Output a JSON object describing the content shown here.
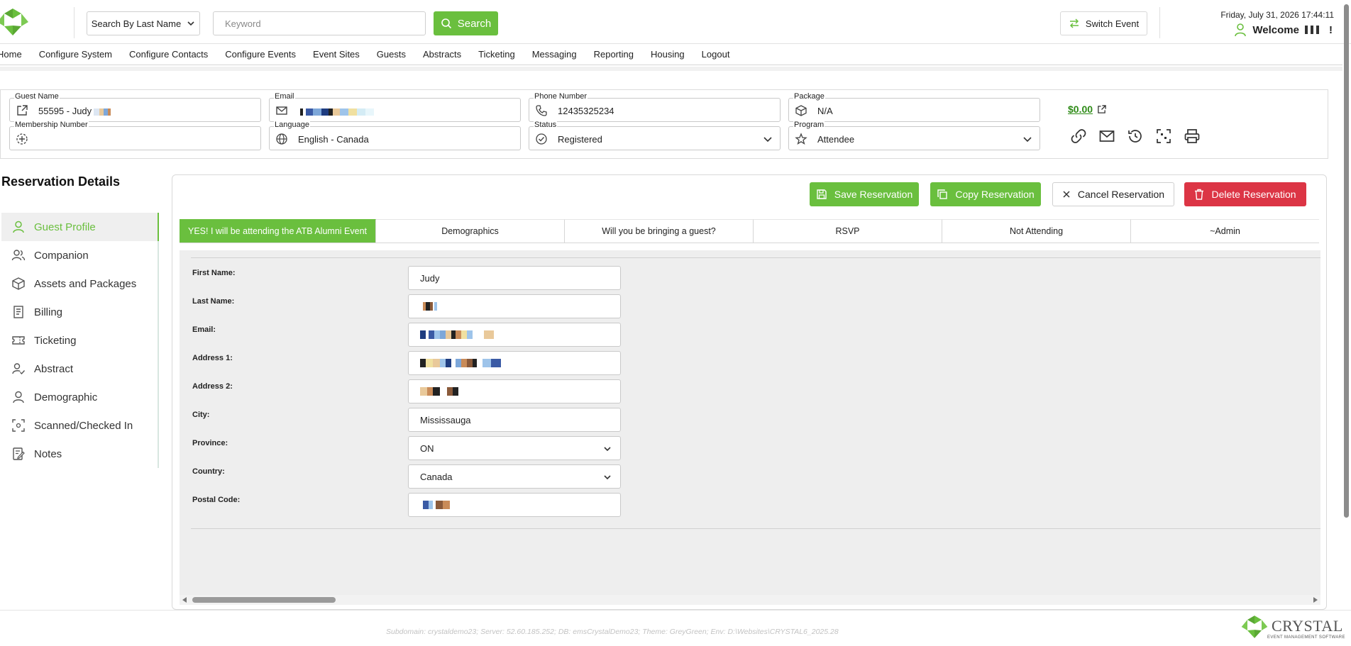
{
  "header": {
    "search_type": "Search By Last Name",
    "keyword_placeholder": "Keyword",
    "search_label": "Search",
    "switch_event_label": "Switch Event",
    "datetime": "Friday, July 31, 2026 17:44:11",
    "welcome": "Welcome",
    "welcome_suffix": "!"
  },
  "nav": [
    "Home",
    "Configure System",
    "Configure Contacts",
    "Configure Events",
    "Event Sites",
    "Guests",
    "Abstracts",
    "Ticketing",
    "Messaging",
    "Reporting",
    "Housing",
    "Logout"
  ],
  "guest": {
    "name_label": "Guest Name",
    "name_value": "55595 - Judy",
    "email_label": "Email",
    "phone_label": "Phone Number",
    "phone_value": "12435325234",
    "package_label": "Package",
    "package_value": "N/A",
    "amount": "$0.00",
    "membership_label": "Membership Number",
    "membership_value": "",
    "language_label": "Language",
    "language_value": "English - Canada",
    "status_label": "Status",
    "status_value": "Registered",
    "program_label": "Program",
    "program_value": "Attendee"
  },
  "reservation": {
    "title": "Reservation Details",
    "save_label": "Save Reservation",
    "copy_label": "Copy Reservation",
    "cancel_label": "Cancel Reservation",
    "delete_label": "Delete Reservation"
  },
  "sidenav": [
    "Guest Profile",
    "Companion",
    "Assets and Packages",
    "Billing",
    "Ticketing",
    "Abstract",
    "Demographic",
    "Scanned/Checked In",
    "Notes"
  ],
  "tabs": [
    "YES! I will be attending the ATB Alumni Event",
    "Demographics",
    "Will you be bringing a guest?",
    "RSVP",
    "Not Attending",
    "~Admin"
  ],
  "form": {
    "first_name_label": "First Name:",
    "first_name_value": "Judy",
    "last_name_label": "Last Name:",
    "email_label": "Email:",
    "address1_label": "Address 1:",
    "address2_label": "Address 2:",
    "city_label": "City:",
    "city_value": "Mississauga",
    "province_label": "Province:",
    "province_value": "ON",
    "country_label": "Country:",
    "country_value": "Canada",
    "postal_label": "Postal Code:"
  },
  "footer": {
    "info": "Subdomain: crystaldemo23; Server: 52.60.185.252; DB: emsCrystalDemo23; Theme: GreyGreen; Env: D:\\Websites\\CRYSTAL6_2025.28",
    "brand": "CRYSTAL",
    "tagline": "EVENT MANAGEMENT SOFTWARE"
  },
  "colors": {
    "accent": "#6abf3e",
    "danger": "#dc3545",
    "amount": "#2e8b17"
  }
}
